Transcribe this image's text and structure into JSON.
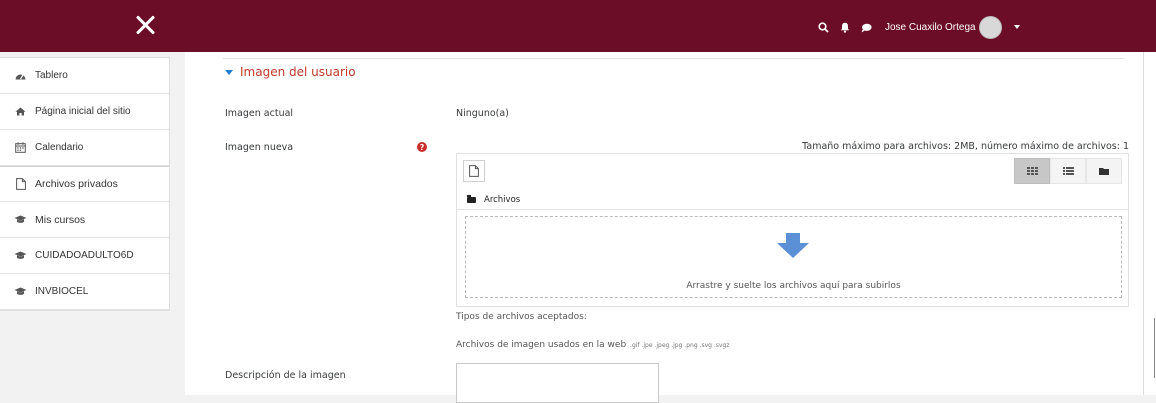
{
  "navbar": {
    "user_name": "Jose Cuaxilo Ortega",
    "icons": [
      "search-icon",
      "bell-icon",
      "chat-icon"
    ],
    "background": "#6b0d26"
  },
  "sidebar": {
    "items": [
      {
        "label": "Tablero",
        "icon": "dashboard-icon"
      },
      {
        "label": "Página inicial del sitio",
        "icon": "home-icon"
      },
      {
        "label": "Calendario",
        "icon": "calendar-icon"
      },
      {
        "label": "Archivos privados",
        "icon": "file-icon"
      },
      {
        "label": "Mis cursos",
        "icon": "graduation-cap-icon"
      },
      {
        "label": "CUIDADOADULTO6D",
        "icon": "graduation-cap-icon"
      },
      {
        "label": "INVBIOCEL",
        "icon": "graduation-cap-icon"
      }
    ]
  },
  "form": {
    "section_title": "Imagen del usuario",
    "current_image_label": "Imagen actual",
    "current_image_value": "Ninguno(a)",
    "new_image_label": "Imagen nueva",
    "max_info": "Tamaño máximo para archivos: 2MB, número máximo de archivos: 1",
    "path_label": "Archivos",
    "drop_text": "Arrastre y suelte los archivos aquí para subirlos",
    "accepted_label": "Tipos de archivos aceptados:",
    "web_types_label": "Archivos de imagen usados en la web",
    "web_types_ext": ".gif .jpe .jpeg .jpg .png .svg .svgz",
    "description_label": "Descripción de la imagen",
    "accent_color": "#c0392b",
    "link_color": "#1f7fd4"
  }
}
